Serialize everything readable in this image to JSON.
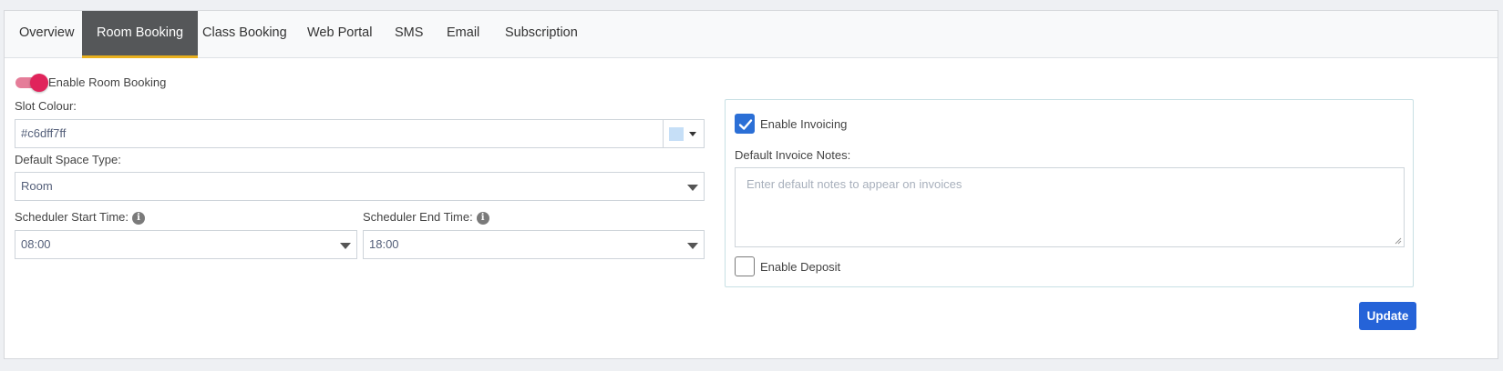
{
  "tabs": [
    {
      "label": "Overview",
      "active": false
    },
    {
      "label": "Room Booking",
      "active": true
    },
    {
      "label": "Class Booking",
      "active": false
    },
    {
      "label": "Web Portal",
      "active": false
    },
    {
      "label": "SMS",
      "active": false
    },
    {
      "label": "Email",
      "active": false
    },
    {
      "label": "Subscription",
      "active": false
    }
  ],
  "room_booking": {
    "enable_label": "Enable Room Booking",
    "enabled": true,
    "slot_colour_label": "Slot Colour:",
    "slot_colour_value": "#c6dff7ff",
    "slot_colour_swatch": "#c6dff7",
    "default_space_type_label": "Default Space Type:",
    "default_space_type_value": "Room",
    "scheduler_start_label": "Scheduler Start Time:",
    "scheduler_start_value": "08:00",
    "scheduler_end_label": "Scheduler End Time:",
    "scheduler_end_value": "18:00"
  },
  "invoicing": {
    "enable_invoicing_label": "Enable Invoicing",
    "enable_invoicing_checked": true,
    "default_notes_label": "Default Invoice Notes:",
    "default_notes_placeholder": "Enter default notes to appear on invoices",
    "enable_deposit_label": "Enable Deposit",
    "enable_deposit_checked": false
  },
  "actions": {
    "update_label": "Update"
  },
  "colors": {
    "active_tab_bg": "#555759",
    "active_tab_underline": "#e8b01e",
    "toggle_on": "#e0245b",
    "checkbox_checked": "#2b6fd6",
    "primary_button": "#2563d8"
  },
  "icons": {
    "info": "info-circle-icon",
    "caret": "caret-down-icon",
    "check": "check-icon"
  }
}
